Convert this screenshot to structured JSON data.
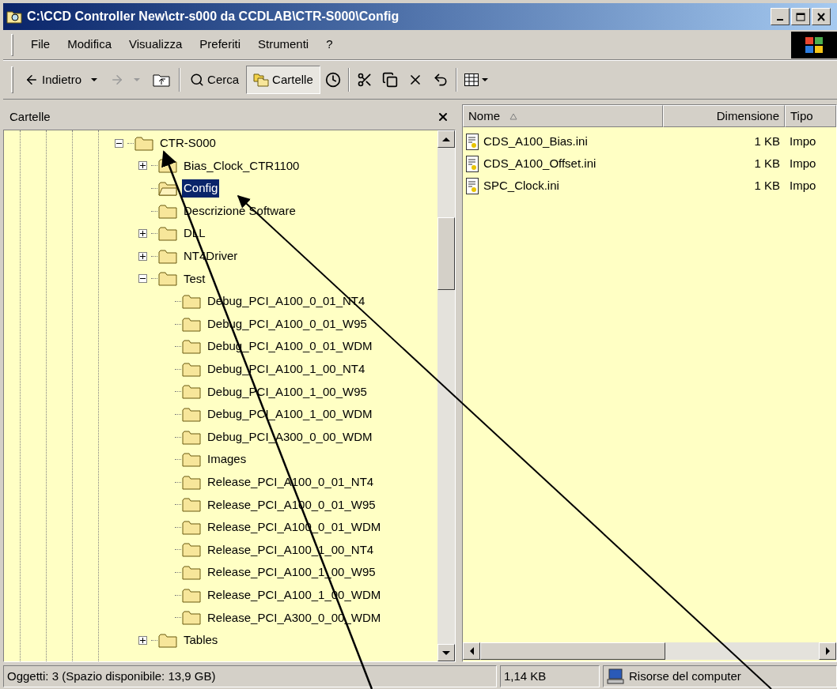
{
  "window": {
    "title": "C:\\CCD Controller New\\ctr-s000 da CCDLAB\\CTR-S000\\Config"
  },
  "menu": [
    "File",
    "Modifica",
    "Visualizza",
    "Preferiti",
    "Strumenti",
    "?"
  ],
  "toolbar": [
    {
      "kind": "back",
      "label": "Indietro",
      "disabled": false
    },
    {
      "kind": "forward",
      "disabled": true
    },
    {
      "kind": "up",
      "disabled": false
    },
    {
      "kind": "separator"
    },
    {
      "kind": "search",
      "label": "Cerca",
      "selected": false
    },
    {
      "kind": "folders",
      "label": "Cartelle",
      "selected": true
    },
    {
      "kind": "history",
      "disabled": false
    },
    {
      "kind": "separator"
    },
    {
      "kind": "move",
      "disabled": false
    },
    {
      "kind": "copy",
      "disabled": false
    },
    {
      "kind": "delete",
      "disabled": false
    },
    {
      "kind": "undo",
      "disabled": false
    },
    {
      "kind": "separator"
    },
    {
      "kind": "views",
      "disabled": false
    }
  ],
  "folders_pane": {
    "title": "Cartelle",
    "tree": [
      {
        "label": "CTR-S000",
        "expanded": true,
        "selected": false,
        "children": [
          {
            "label": "Bias_Clock_CTR1100",
            "expanded": false,
            "selected": false
          },
          {
            "label": "Config",
            "selected": true
          },
          {
            "label": "Descrizione Software",
            "selected": false
          },
          {
            "label": "DLL",
            "expanded": false,
            "selected": false
          },
          {
            "label": "NT4Driver",
            "expanded": false,
            "selected": false
          },
          {
            "label": "Test",
            "expanded": true,
            "selected": false,
            "children": [
              {
                "label": "Debug_PCI_A100_0_01_NT4",
                "selected": false
              },
              {
                "label": "Debug_PCI_A100_0_01_W95",
                "selected": false
              },
              {
                "label": "Debug_PCI_A100_0_01_WDM",
                "selected": false
              },
              {
                "label": "Debug_PCI_A100_1_00_NT4",
                "selected": false
              },
              {
                "label": "Debug_PCI_A100_1_00_W95",
                "selected": false
              },
              {
                "label": "Debug_PCI_A100_1_00_WDM",
                "selected": false
              },
              {
                "label": "Debug_PCI_A300_0_00_WDM",
                "selected": false
              },
              {
                "label": "Images",
                "selected": false
              },
              {
                "label": "Release_PCI_A100_0_01_NT4",
                "selected": false
              },
              {
                "label": "Release_PCI_A100_0_01_W95",
                "selected": false
              },
              {
                "label": "Release_PCI_A100_0_01_WDM",
                "selected": false
              },
              {
                "label": "Release_PCI_A100_1_00_NT4",
                "selected": false
              },
              {
                "label": "Release_PCI_A100_1_00_W95",
                "selected": false
              },
              {
                "label": "Release_PCI_A100_1_00_WDM",
                "selected": false
              },
              {
                "label": "Release_PCI_A300_0_00_WDM",
                "selected": false
              }
            ]
          },
          {
            "label": "Tables",
            "expanded": false,
            "selected": false
          }
        ]
      }
    ]
  },
  "file_list": {
    "columns": [
      {
        "label": "Nome",
        "sorted": true
      },
      {
        "label": "Dimensione",
        "sorted": false
      },
      {
        "label": "Tipo",
        "sorted": false
      }
    ],
    "rows": [
      {
        "name": "CDS_A100_Bias.ini",
        "size": "1 KB",
        "type": "Impo"
      },
      {
        "name": "CDS_A100_Offset.ini",
        "size": "1 KB",
        "type": "Impo"
      },
      {
        "name": "SPC_Clock.ini",
        "size": "1 KB",
        "type": "Impo"
      }
    ]
  },
  "status_bar": {
    "objects": "Oggetti: 3 (Spazio disponibile: 13,9 GB)",
    "size": "1,14 KB",
    "location": "Risorse del computer"
  }
}
